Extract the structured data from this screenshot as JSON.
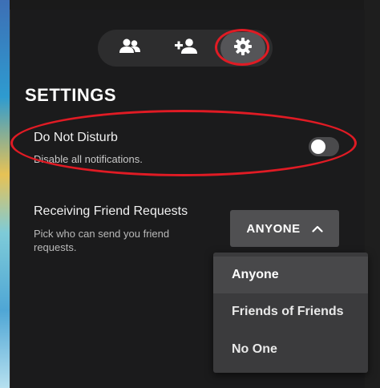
{
  "tabs": [
    {
      "icon": "friends-icon"
    },
    {
      "icon": "add-friend-icon"
    },
    {
      "icon": "gear-icon",
      "selected": true
    }
  ],
  "settings": {
    "title": "SETTINGS",
    "do_not_disturb": {
      "label": "Do Not Disturb",
      "description": "Disable all notifications.",
      "enabled": false
    },
    "friend_requests": {
      "label": "Receiving Friend Requests",
      "description": "Pick who can send you friend requests.",
      "selected_value": "ANYONE",
      "options": [
        "Anyone",
        "Friends of Friends",
        "No One"
      ]
    }
  },
  "colors": {
    "annotation_ring": "#e01b24",
    "panel_bg": "#1b1b1c",
    "dropdown_bg": "#3b3b3d",
    "selected_button_bg": "#505052"
  }
}
